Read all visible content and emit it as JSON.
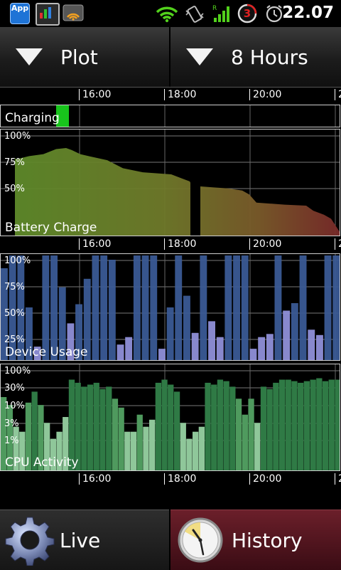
{
  "status_bar": {
    "app_badge": "App",
    "notification_count": "3",
    "time": "22.07",
    "icons": [
      "app-icon",
      "system-monitor-icon",
      "wifi-notification-icon",
      "wifi-signal-icon",
      "vibrate-icon",
      "cell-signal-icon",
      "battery-counter-icon",
      "alarm-clock-icon"
    ]
  },
  "top_bar": {
    "plot_label": "Plot",
    "duration_label": "8 Hours"
  },
  "time_axis": {
    "ticks": [
      "16:00",
      "18:00",
      "20:00",
      "2"
    ]
  },
  "panels": {
    "charging": {
      "title": "Charging",
      "color": "#18c41c"
    },
    "battery": {
      "title": "Battery Charge",
      "labels": [
        "100%",
        "75%",
        "50%"
      ]
    },
    "device_usage": {
      "title": "Device Usage",
      "labels": [
        "100%",
        "75%",
        "50%",
        "25%"
      ]
    },
    "cpu": {
      "title": "CPU Activity",
      "labels": [
        "100%",
        "30%",
        "10%",
        "3%",
        "1%"
      ]
    }
  },
  "chart_data": [
    {
      "type": "bar",
      "title": "Charging",
      "x_range": [
        "14:00",
        "22:00"
      ],
      "series": [
        {
          "name": "Charging",
          "segments": [
            {
              "start": "15:15",
              "end": "15:33"
            }
          ]
        }
      ]
    },
    {
      "type": "area",
      "title": "Battery Charge",
      "ylim": [
        0,
        100
      ],
      "x": [
        "14:15",
        "14:30",
        "15:00",
        "15:15",
        "15:30",
        "15:45",
        "16:00",
        "16:15",
        "16:30",
        "16:45",
        "17:00",
        "17:30",
        "18:00",
        "18:15",
        "18:30",
        "18:45",
        "19:00",
        "19:15",
        "19:30",
        "19:45",
        "20:00",
        "20:30",
        "21:00",
        "21:15",
        "21:30",
        "21:45",
        "22:00"
      ],
      "values": [
        78,
        77,
        80,
        82,
        87,
        88,
        86,
        82,
        79,
        76,
        68,
        64,
        62,
        55,
        50,
        50,
        49,
        48,
        46,
        42,
        34,
        32,
        31,
        26,
        22,
        18,
        3
      ]
    },
    {
      "type": "bar",
      "title": "Device Usage",
      "ylim": [
        0,
        100
      ],
      "values": [
        88,
        100,
        100,
        51,
        14,
        100,
        100,
        70,
        36,
        54,
        78,
        100,
        100,
        96,
        16,
        23,
        100,
        100,
        100,
        12,
        51,
        100,
        62,
        27,
        100,
        38,
        23,
        100,
        100,
        100,
        12,
        23,
        26,
        100,
        48,
        55,
        100,
        30,
        25,
        100,
        100
      ]
    },
    {
      "type": "bar",
      "title": "CPU Activity",
      "ylim": [
        "1%",
        "100%"
      ],
      "yscale": "log",
      "values": [
        22,
        14,
        4,
        3,
        16,
        30,
        14,
        5,
        2,
        3,
        7,
        60,
        50,
        40,
        45,
        50,
        35,
        40,
        20,
        12,
        3,
        3,
        8,
        4,
        6,
        50,
        60,
        45,
        30,
        5,
        2,
        3,
        4,
        50,
        45,
        60,
        55,
        40,
        20,
        8,
        20,
        5,
        40,
        35,
        50,
        60,
        60,
        55,
        50,
        55,
        60,
        65,
        55,
        60,
        60
      ]
    }
  ],
  "bottom_bar": {
    "live_label": "Live",
    "history_label": "History"
  }
}
